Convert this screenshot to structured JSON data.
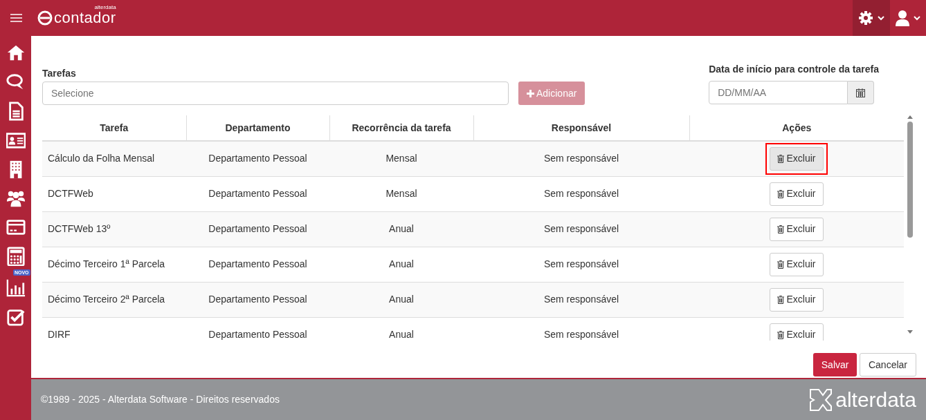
{
  "header": {
    "logo_small": "alterdata",
    "logo": "contador"
  },
  "sidebar": {
    "items": [
      {
        "kind": "home"
      },
      {
        "kind": "chat"
      },
      {
        "kind": "document"
      },
      {
        "kind": "idcard"
      },
      {
        "kind": "building"
      },
      {
        "kind": "users"
      },
      {
        "kind": "card"
      },
      {
        "kind": "calculator"
      },
      {
        "kind": "chart",
        "badge": "NOVO"
      },
      {
        "kind": "check"
      }
    ]
  },
  "form": {
    "tasks_label": "Tarefas",
    "tasks_placeholder": "Selecione",
    "add_button": {
      "label": "Adicionar",
      "disabled": true
    },
    "date_label": "Data de início para controle da tarefa",
    "date_placeholder": "DD/MM/AA"
  },
  "table": {
    "columns": [
      "Tarefa",
      "Departamento",
      "Recorrência da tarefa",
      "Responsável",
      "Ações"
    ],
    "rows": [
      {
        "cells": [
          "Cálculo da Folha Mensal",
          "Departamento Pessoal",
          "Mensal",
          "Sem responsável"
        ],
        "action": "Excluir",
        "highlighted": true
      },
      {
        "cells": [
          "DCTFWeb",
          "Departamento Pessoal",
          "Mensal",
          "Sem responsável"
        ],
        "action": "Excluir",
        "highlighted": false
      },
      {
        "cells": [
          "DCTFWeb 13º",
          "Departamento Pessoal",
          "Anual",
          "Sem responsável"
        ],
        "action": "Excluir",
        "highlighted": false
      },
      {
        "cells": [
          "Décimo Terceiro 1ª Parcela",
          "Departamento Pessoal",
          "Anual",
          "Sem responsável"
        ],
        "action": "Excluir",
        "highlighted": false
      },
      {
        "cells": [
          "Décimo Terceiro 2ª Parcela",
          "Departamento Pessoal",
          "Anual",
          "Sem responsável"
        ],
        "action": "Excluir",
        "highlighted": false
      },
      {
        "cells": [
          "DIRF",
          "Departamento Pessoal",
          "Anual",
          "Sem responsável"
        ],
        "action": "Excluir",
        "highlighted": false
      }
    ]
  },
  "buttons": {
    "save": "Salvar",
    "cancel": "Cancelar"
  },
  "footer": {
    "text": "©1989 - 2025 - Alterdata Software - Direitos reservados",
    "brand": "alterdata"
  }
}
